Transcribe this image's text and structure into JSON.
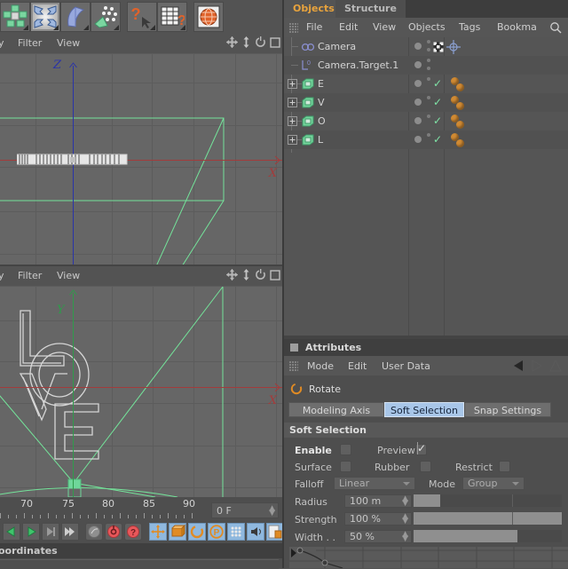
{
  "app": {
    "name": "Cinema 4D"
  },
  "toolbar": {
    "buttons": [
      {
        "name": "deformer-tool",
        "icon": "green-cluster-icon",
        "selected": false
      },
      {
        "name": "magnet-tool",
        "icon": "four-arrows-icon",
        "selected": true
      },
      {
        "name": "bend-object-tool",
        "icon": "blue-bend-icon",
        "selected": false
      },
      {
        "name": "particle-emitter-tool",
        "icon": "particles-icon",
        "selected": false
      },
      {
        "name": "help-cursor-tool",
        "icon": "question-cursor-icon",
        "selected": false
      },
      {
        "name": "script-help-tool",
        "icon": "table-question-icon",
        "selected": false
      },
      {
        "name": "web-help-tool",
        "icon": "globe-icon",
        "selected": false
      }
    ]
  },
  "viewport_top": {
    "menu": [
      "y",
      "Filter",
      "View"
    ],
    "menu_truncated_first": "y",
    "axis_vertical_label": "Z",
    "axis_horizontal_label": "X",
    "icons": [
      "move-icon",
      "updown-icon",
      "rotate-icon",
      "maximize-icon"
    ]
  },
  "viewport_bottom": {
    "menu": [
      "y",
      "Filter",
      "View"
    ],
    "axis_vertical_label": "Y",
    "axis_horizontal_label": "X",
    "icons": [
      "move-icon",
      "updown-icon",
      "rotate-icon",
      "maximize-icon"
    ],
    "text_object": "LOVE"
  },
  "objects_panel": {
    "tabs": [
      {
        "label": "Objects",
        "active": true
      },
      {
        "label": "Structure",
        "active": false
      }
    ],
    "menu": [
      "File",
      "Edit",
      "View",
      "Objects",
      "Tags",
      "Bookma"
    ],
    "search_icon": "search-icon",
    "grip_icon": "grip-icon",
    "rows": [
      {
        "name": "Camera",
        "icon": "camera-icon",
        "expandable": false,
        "visible_dot": true,
        "check": false,
        "tags": 0,
        "extra_icons": [
          "target-tag-icon",
          "axis-icon"
        ]
      },
      {
        "name": "Camera.Target.1",
        "icon": "target-null-icon",
        "expandable": false,
        "visible_dot": true,
        "check": false,
        "tags": 0,
        "extra_icons": []
      },
      {
        "name": "E",
        "icon": "text-object-icon",
        "expandable": true,
        "visible_dot": true,
        "check": true,
        "tags": 2,
        "extra_icons": []
      },
      {
        "name": "V",
        "icon": "text-object-icon",
        "expandable": true,
        "visible_dot": true,
        "check": true,
        "tags": 2,
        "extra_icons": []
      },
      {
        "name": "O",
        "icon": "text-object-icon",
        "expandable": true,
        "visible_dot": true,
        "check": true,
        "tags": 2,
        "extra_icons": []
      },
      {
        "name": "L",
        "icon": "text-object-icon",
        "expandable": true,
        "visible_dot": true,
        "check": true,
        "tags": 2,
        "extra_icons": []
      }
    ]
  },
  "attributes_panel": {
    "title": "Attributes",
    "menu": [
      "Mode",
      "Edit",
      "User Data"
    ],
    "nav_icons": [
      "back-arrow-icon",
      "forward-arrow-icon",
      "up-arrow-icon"
    ],
    "tool_name": "Rotate",
    "tool_icon": "rotate-icon",
    "tabs": [
      {
        "label": "Modeling Axis",
        "active": false
      },
      {
        "label": "Soft Selection",
        "active": true
      },
      {
        "label": "Snap Settings",
        "active": false
      }
    ],
    "section_title": "Soft Selection",
    "fields": {
      "enable": {
        "label": "Enable",
        "checked": false
      },
      "preview": {
        "label": "Preview",
        "checked": true
      },
      "surface": {
        "label": "Surface",
        "checked": false
      },
      "rubber": {
        "label": "Rubber",
        "checked": false
      },
      "restrict": {
        "label": "Restrict",
        "checked": false
      },
      "falloff": {
        "label": "Falloff",
        "value": "Linear"
      },
      "mode": {
        "label": "Mode",
        "value": "Group"
      },
      "radius": {
        "label": "Radius",
        "value": "100 m",
        "fill_pct": 18
      },
      "strength": {
        "label": "Strength",
        "value": "100 %",
        "fill_pct": 100
      },
      "width": {
        "label": "Width  . .",
        "value": "50 %",
        "fill_pct": 70
      }
    },
    "curve_label": "falloff-curve"
  },
  "timeline": {
    "ruler_labels": [
      "70",
      "75",
      "80",
      "85",
      "90"
    ],
    "frame_field": {
      "value": "0 F"
    },
    "transport": [
      {
        "name": "play-back-button",
        "icon": "triangle-left-green"
      },
      {
        "name": "play-forward-button",
        "icon": "triangle-right-green"
      },
      {
        "name": "next-frame-button",
        "icon": "step-forward"
      },
      {
        "name": "goto-end-button",
        "icon": "skip-end"
      }
    ],
    "record": [
      {
        "name": "autokey-button",
        "icon": "key-icon"
      },
      {
        "name": "record-button",
        "icon": "record-red-icon"
      },
      {
        "name": "keyframe-help-button",
        "icon": "question-red-icon"
      }
    ],
    "modes": [
      {
        "name": "move-mode-button",
        "icon": "move-icon",
        "active": true
      },
      {
        "name": "scale-mode-button",
        "icon": "scale-icon",
        "active": true
      },
      {
        "name": "rotate-mode-button",
        "icon": "rotate-icon",
        "active": true
      },
      {
        "name": "param-mode-button",
        "icon": "p-circle-icon",
        "active": true
      },
      {
        "name": "points-mode-button",
        "icon": "dots-grid-icon",
        "active": true
      },
      {
        "name": "sound-mode-button",
        "icon": "sound-icon",
        "active": true
      },
      {
        "name": "layer-mode-button",
        "icon": "layer-icon",
        "active": true
      }
    ]
  },
  "coordinates_bar": {
    "title": "oordinates"
  }
}
